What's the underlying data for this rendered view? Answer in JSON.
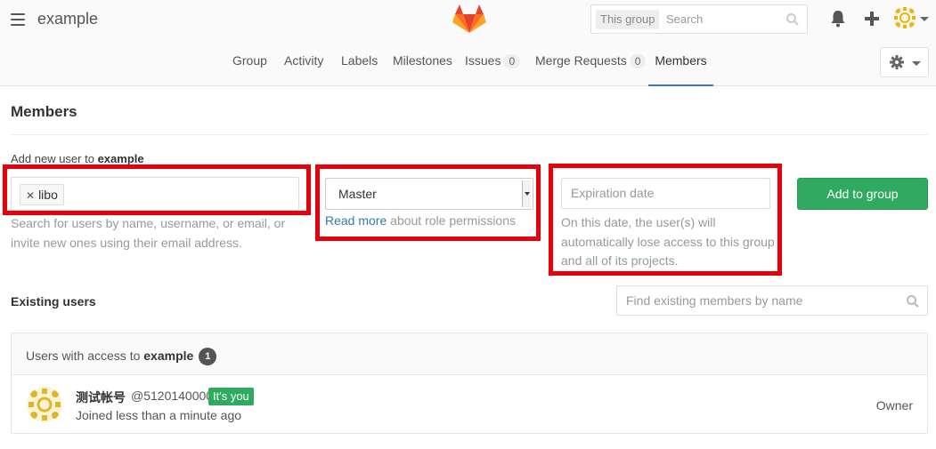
{
  "header": {
    "title": "example",
    "search_scope": "This group",
    "search_placeholder": "Search"
  },
  "nav": {
    "tabs": [
      {
        "label": "Group"
      },
      {
        "label": "Activity"
      },
      {
        "label": "Labels"
      },
      {
        "label": "Milestones"
      },
      {
        "label": "Issues",
        "count": "0"
      },
      {
        "label": "Merge Requests",
        "count": "0"
      },
      {
        "label": "Members"
      }
    ],
    "active": "Members"
  },
  "page": {
    "title": "Members",
    "add_user_prefix": "Add new user to",
    "group_name": "example",
    "user_token": "libo",
    "user_help": "Search for users by name, username, or email, or invite new ones using their email address.",
    "role_value": "Master",
    "read_more": "Read more",
    "role_help_suffix": " about role permissions",
    "expiration_placeholder": "Expiration date",
    "expiration_help": "On this date, the user(s) will automatically lose access to this group and all of its projects.",
    "add_button": "Add to group",
    "existing_label": "Existing users",
    "find_placeholder": "Find existing members by name"
  },
  "members_panel": {
    "prefix": "Users with access to",
    "group_name": "example",
    "count": "1",
    "members": [
      {
        "name": "测试帐号",
        "username": "@5120140000",
        "badge": "It's you",
        "joined": "Joined less than a minute ago",
        "role": "Owner"
      }
    ]
  },
  "colors": {
    "accent_green": "#2faa60",
    "highlight_red": "#e8000b",
    "link_blue": "#3777b0",
    "active_tab_underline": "#3c78c8"
  }
}
